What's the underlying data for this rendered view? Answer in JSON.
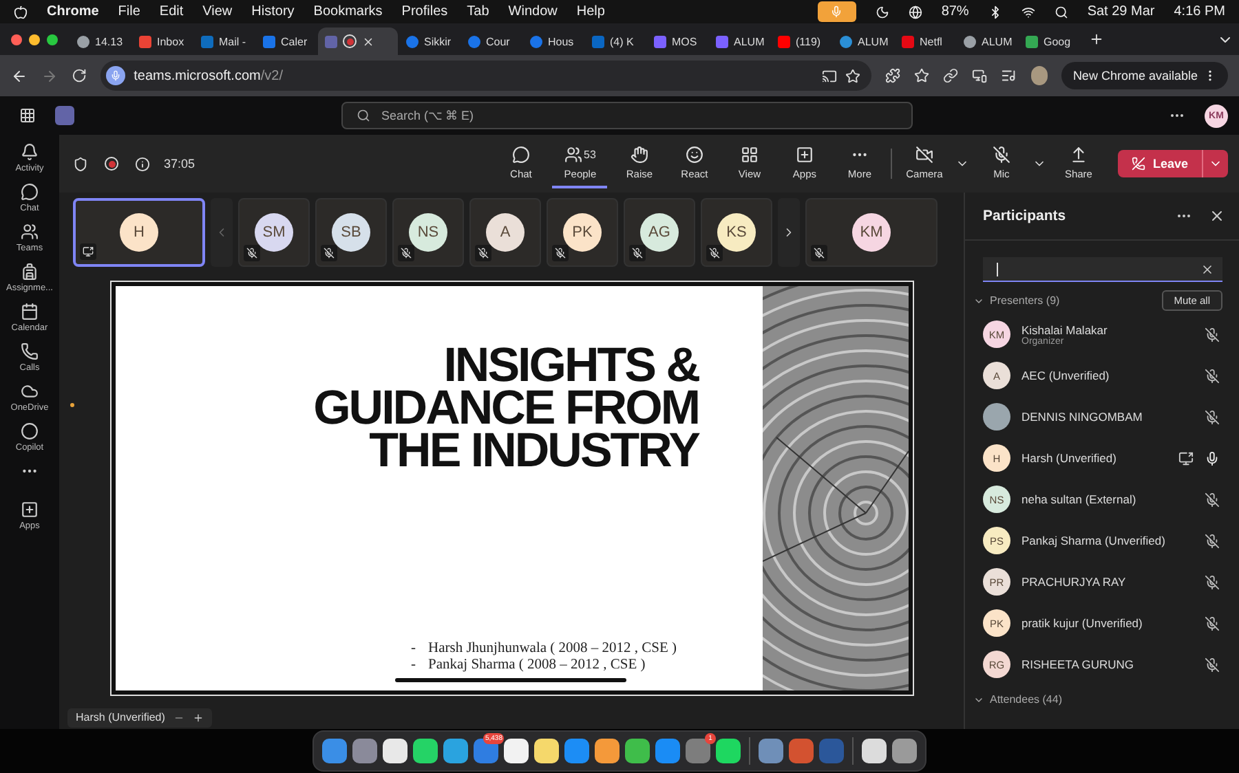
{
  "menubar": {
    "app": "Chrome",
    "items": [
      "File",
      "Edit",
      "View",
      "History",
      "Bookmarks",
      "Profiles",
      "Tab",
      "Window",
      "Help"
    ],
    "battery": "87%",
    "date": "Sat 29 Mar",
    "time": "4:16 PM"
  },
  "tabs": [
    {
      "kind": "globe",
      "label": "14.13",
      "selected": false
    },
    {
      "kind": "gmail",
      "label": "Inbox",
      "selected": false
    },
    {
      "kind": "outlook",
      "label": "Mail -",
      "selected": false
    },
    {
      "kind": "calendar",
      "label": "Caler",
      "selected": false
    },
    {
      "kind": "teams",
      "selected": true
    },
    {
      "kind": "c",
      "label": "Sikkir",
      "selected": false
    },
    {
      "kind": "c",
      "label": "Cour",
      "selected": false
    },
    {
      "kind": "c",
      "label": "Hous",
      "selected": false
    },
    {
      "kind": "linkedin",
      "label": "(4) K",
      "selected": false
    },
    {
      "kind": "app",
      "label": "MOS",
      "selected": false
    },
    {
      "kind": "app",
      "label": "ALUM",
      "selected": false
    },
    {
      "kind": "youtube",
      "label": "(119)",
      "selected": false
    },
    {
      "kind": "edge",
      "label": "ALUM",
      "selected": false
    },
    {
      "kind": "netflix",
      "label": "Netfl",
      "selected": false
    },
    {
      "kind": "globe",
      "label": "ALUM",
      "selected": false
    },
    {
      "kind": "google",
      "label": "Goog",
      "selected": false
    }
  ],
  "address": {
    "host": "teams.microsoft.com",
    "path": "/v2/",
    "update_button": "New Chrome available"
  },
  "teams_header": {
    "search_placeholder": "Search (⌥ ⌘ E)",
    "avatar": "KM"
  },
  "rail": [
    {
      "kind": "activity",
      "label": "Activity"
    },
    {
      "kind": "chat",
      "label": "Chat"
    },
    {
      "kind": "teams",
      "label": "Teams"
    },
    {
      "kind": "assignments",
      "label": "Assignme..."
    },
    {
      "kind": "calendar",
      "label": "Calendar"
    },
    {
      "kind": "calls",
      "label": "Calls"
    },
    {
      "kind": "onedrive",
      "label": "OneDrive"
    },
    {
      "kind": "copilot",
      "label": "Copilot"
    },
    {
      "kind": "more"
    },
    {
      "kind": "apps",
      "label": "Apps"
    }
  ],
  "meeting_toolbar": {
    "timer": "37:05",
    "buttons": [
      {
        "kind": "chat",
        "label": "Chat",
        "selected": false
      },
      {
        "kind": "people",
        "label": "People",
        "count": "53",
        "selected": true
      },
      {
        "kind": "raise",
        "label": "Raise",
        "selected": false
      },
      {
        "kind": "react",
        "label": "React",
        "selected": false
      },
      {
        "kind": "view",
        "label": "View",
        "selected": false
      },
      {
        "kind": "apps",
        "label": "Apps",
        "selected": false
      },
      {
        "kind": "more",
        "label": "More",
        "selected": false
      },
      {
        "kind": "camera",
        "label": "Camera",
        "selected": false
      },
      {
        "kind": "mic",
        "label": "Mic",
        "selected": false
      },
      {
        "kind": "share",
        "label": "Share",
        "selected": false
      }
    ],
    "leave": "Leave"
  },
  "video_tiles": [
    {
      "initials": "H",
      "color": "#fbe3c8",
      "sharing": true,
      "selected": true
    },
    {
      "initials": "SM",
      "color": "#d8d8f0",
      "sharing": false,
      "selected": false
    },
    {
      "initials": "SB",
      "color": "#d6e0ea",
      "sharing": false,
      "selected": false
    },
    {
      "initials": "NS",
      "color": "#d7eadd",
      "sharing": false,
      "selected": false
    },
    {
      "initials": "A",
      "color": "#eadfd8",
      "sharing": false,
      "selected": false
    },
    {
      "initials": "PK",
      "color": "#fbe3c8",
      "sharing": false,
      "selected": false
    },
    {
      "initials": "AG",
      "color": "#d7eadd",
      "sharing": false,
      "selected": false
    },
    {
      "initials": "KS",
      "color": "#f7ebc1",
      "sharing": false,
      "selected": false
    },
    {
      "initials": "KM",
      "color": "#f6d6e2",
      "sharing": false,
      "selected": false
    }
  ],
  "slide": {
    "title": [
      "INSIGHTS &",
      "GUIDANCE FROM",
      "THE INDUSTRY"
    ],
    "bullets": [
      {
        "marker": "-",
        "text": "Harsh Jhunjhunwala ( 2008 – 2012 , CSE )"
      },
      {
        "marker": "-",
        "text": "Pankaj Sharma ( 2008 – 2012 , CSE )"
      }
    ]
  },
  "presenter_label": "Harsh (Unverified)",
  "participants": {
    "title": "Participants",
    "presenters_heading": "Presenters (9)",
    "mute_all": "Mute all",
    "presenters": [
      {
        "initials": "KM",
        "color": "#f6d6e2",
        "photo": false,
        "name": "Kishalai Malakar",
        "role": "Organizer",
        "muted": true,
        "sharing": false
      },
      {
        "initials": "A",
        "color": "#eadfd8",
        "photo": false,
        "name": "AEC (Unverified)",
        "muted": true,
        "sharing": false
      },
      {
        "photo": true,
        "name": "DENNIS NINGOMBAM",
        "muted": true,
        "sharing": false
      },
      {
        "initials": "H",
        "color": "#fbe3c8",
        "photo": false,
        "name": "Harsh (Unverified)",
        "muted": false,
        "sharing": true
      },
      {
        "initials": "NS",
        "color": "#d7eadd",
        "photo": false,
        "name": "neha sultan (External)",
        "muted": true,
        "sharing": false
      },
      {
        "initials": "PS",
        "color": "#f7ebc1",
        "photo": false,
        "name": "Pankaj Sharma (Unverified)",
        "muted": true,
        "sharing": false
      },
      {
        "initials": "PR",
        "color": "#eadfd8",
        "photo": false,
        "name": "PRACHURJYA RAY",
        "muted": true,
        "sharing": false
      },
      {
        "initials": "PK",
        "color": "#fbe3c8",
        "photo": false,
        "name": "pratik kujur (Unverified)",
        "muted": true,
        "sharing": false
      },
      {
        "initials": "RG",
        "color": "#f3d8d2",
        "photo": false,
        "name": "RISHEETA GURUNG",
        "muted": true,
        "sharing": false
      }
    ],
    "attendees_heading": "Attendees (44)"
  },
  "dock": [
    {
      "kind": "finder"
    },
    {
      "kind": "launchpad"
    },
    {
      "kind": "chrome"
    },
    {
      "kind": "whatsapp"
    },
    {
      "kind": "telegram"
    },
    {
      "kind": "mail",
      "badge": "5,438"
    },
    {
      "kind": "reminders"
    },
    {
      "kind": "notes"
    },
    {
      "kind": "keynote"
    },
    {
      "kind": "pages"
    },
    {
      "kind": "numbers"
    },
    {
      "kind": "appstore"
    },
    {
      "kind": "settings",
      "badge": "1"
    },
    {
      "kind": "spotify"
    },
    {
      "kind": "divider"
    },
    {
      "kind": "preview"
    },
    {
      "kind": "powerpoint"
    },
    {
      "kind": "word"
    },
    {
      "kind": "divider"
    },
    {
      "kind": "folder"
    },
    {
      "kind": "trash"
    }
  ]
}
